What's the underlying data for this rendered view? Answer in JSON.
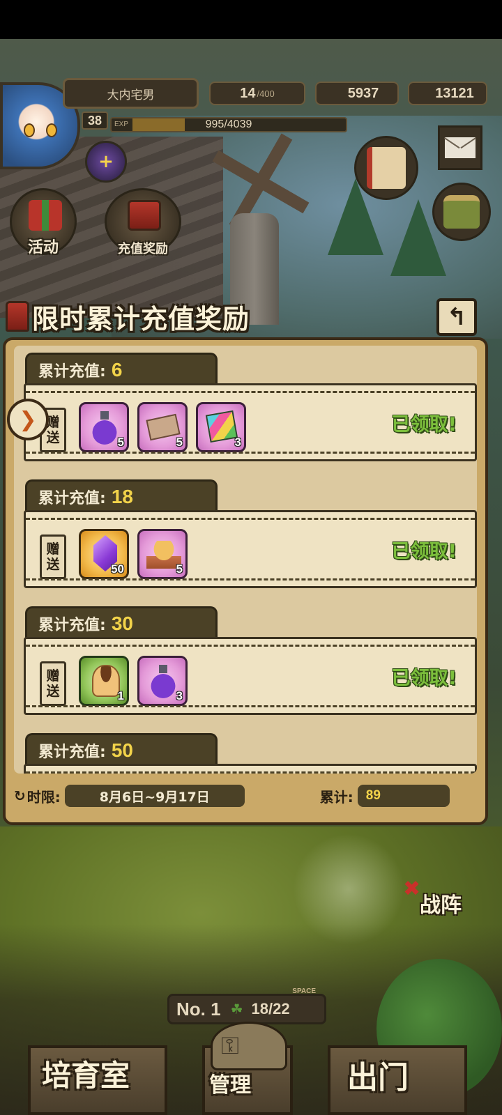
{
  "hud": {
    "player_name": "大内宅男",
    "level": "38",
    "exp_tag": "EXP",
    "exp_text": "995/4039",
    "exp_progress": 0.246,
    "stamina": "14",
    "stamina_max": "/400",
    "gold": "5937",
    "gems": "13121"
  },
  "side_buttons": {
    "activity": "活动",
    "recharge_reward": "充值奖励"
  },
  "panel": {
    "title": "限时累计充值奖励",
    "back_icon": "back-arrow-icon",
    "tiers": [
      {
        "label": "累计充值:",
        "amount": "6",
        "gift_tag": [
          "赠",
          "送"
        ],
        "items": [
          {
            "icon": "purple-potion-icon",
            "count": "5",
            "rarity": "purple"
          },
          {
            "icon": "ticket-icon",
            "count": "5",
            "rarity": "purple"
          },
          {
            "icon": "rainbow-book-icon",
            "count": "3",
            "rarity": "purple"
          }
        ],
        "status": "已领取!"
      },
      {
        "label": "累计充值:",
        "amount": "18",
        "gift_tag": [
          "赠",
          "送"
        ],
        "items": [
          {
            "icon": "purple-gem-icon",
            "count": "50",
            "rarity": "gold"
          },
          {
            "icon": "bread-basket-icon",
            "count": "5",
            "rarity": "purple"
          }
        ],
        "status": "已领取!"
      },
      {
        "label": "累计充值:",
        "amount": "30",
        "gift_tag": [
          "赠",
          "送"
        ],
        "items": [
          {
            "icon": "pudding-icon",
            "count": "1",
            "rarity": "green"
          },
          {
            "icon": "purple-potion-icon",
            "count": "3",
            "rarity": "purple"
          }
        ],
        "status": "已领取!"
      },
      {
        "label": "累计充值:",
        "amount": "50"
      }
    ],
    "time_label": "时限:",
    "time_range": "8月6日~9月17日",
    "total_label": "累计:",
    "total_value": "89"
  },
  "scene": {
    "formation": "战阵",
    "room_no": "No. 1",
    "space_label": "SPACE",
    "space_value": "18/22",
    "nav_left": "培育室",
    "nav_mid": "管理",
    "nav_right": "出门"
  },
  "colors": {
    "panel_bg": "#caa968",
    "claimed_green": "#7cbf3c",
    "amount_yellow": "#f2d34a"
  }
}
